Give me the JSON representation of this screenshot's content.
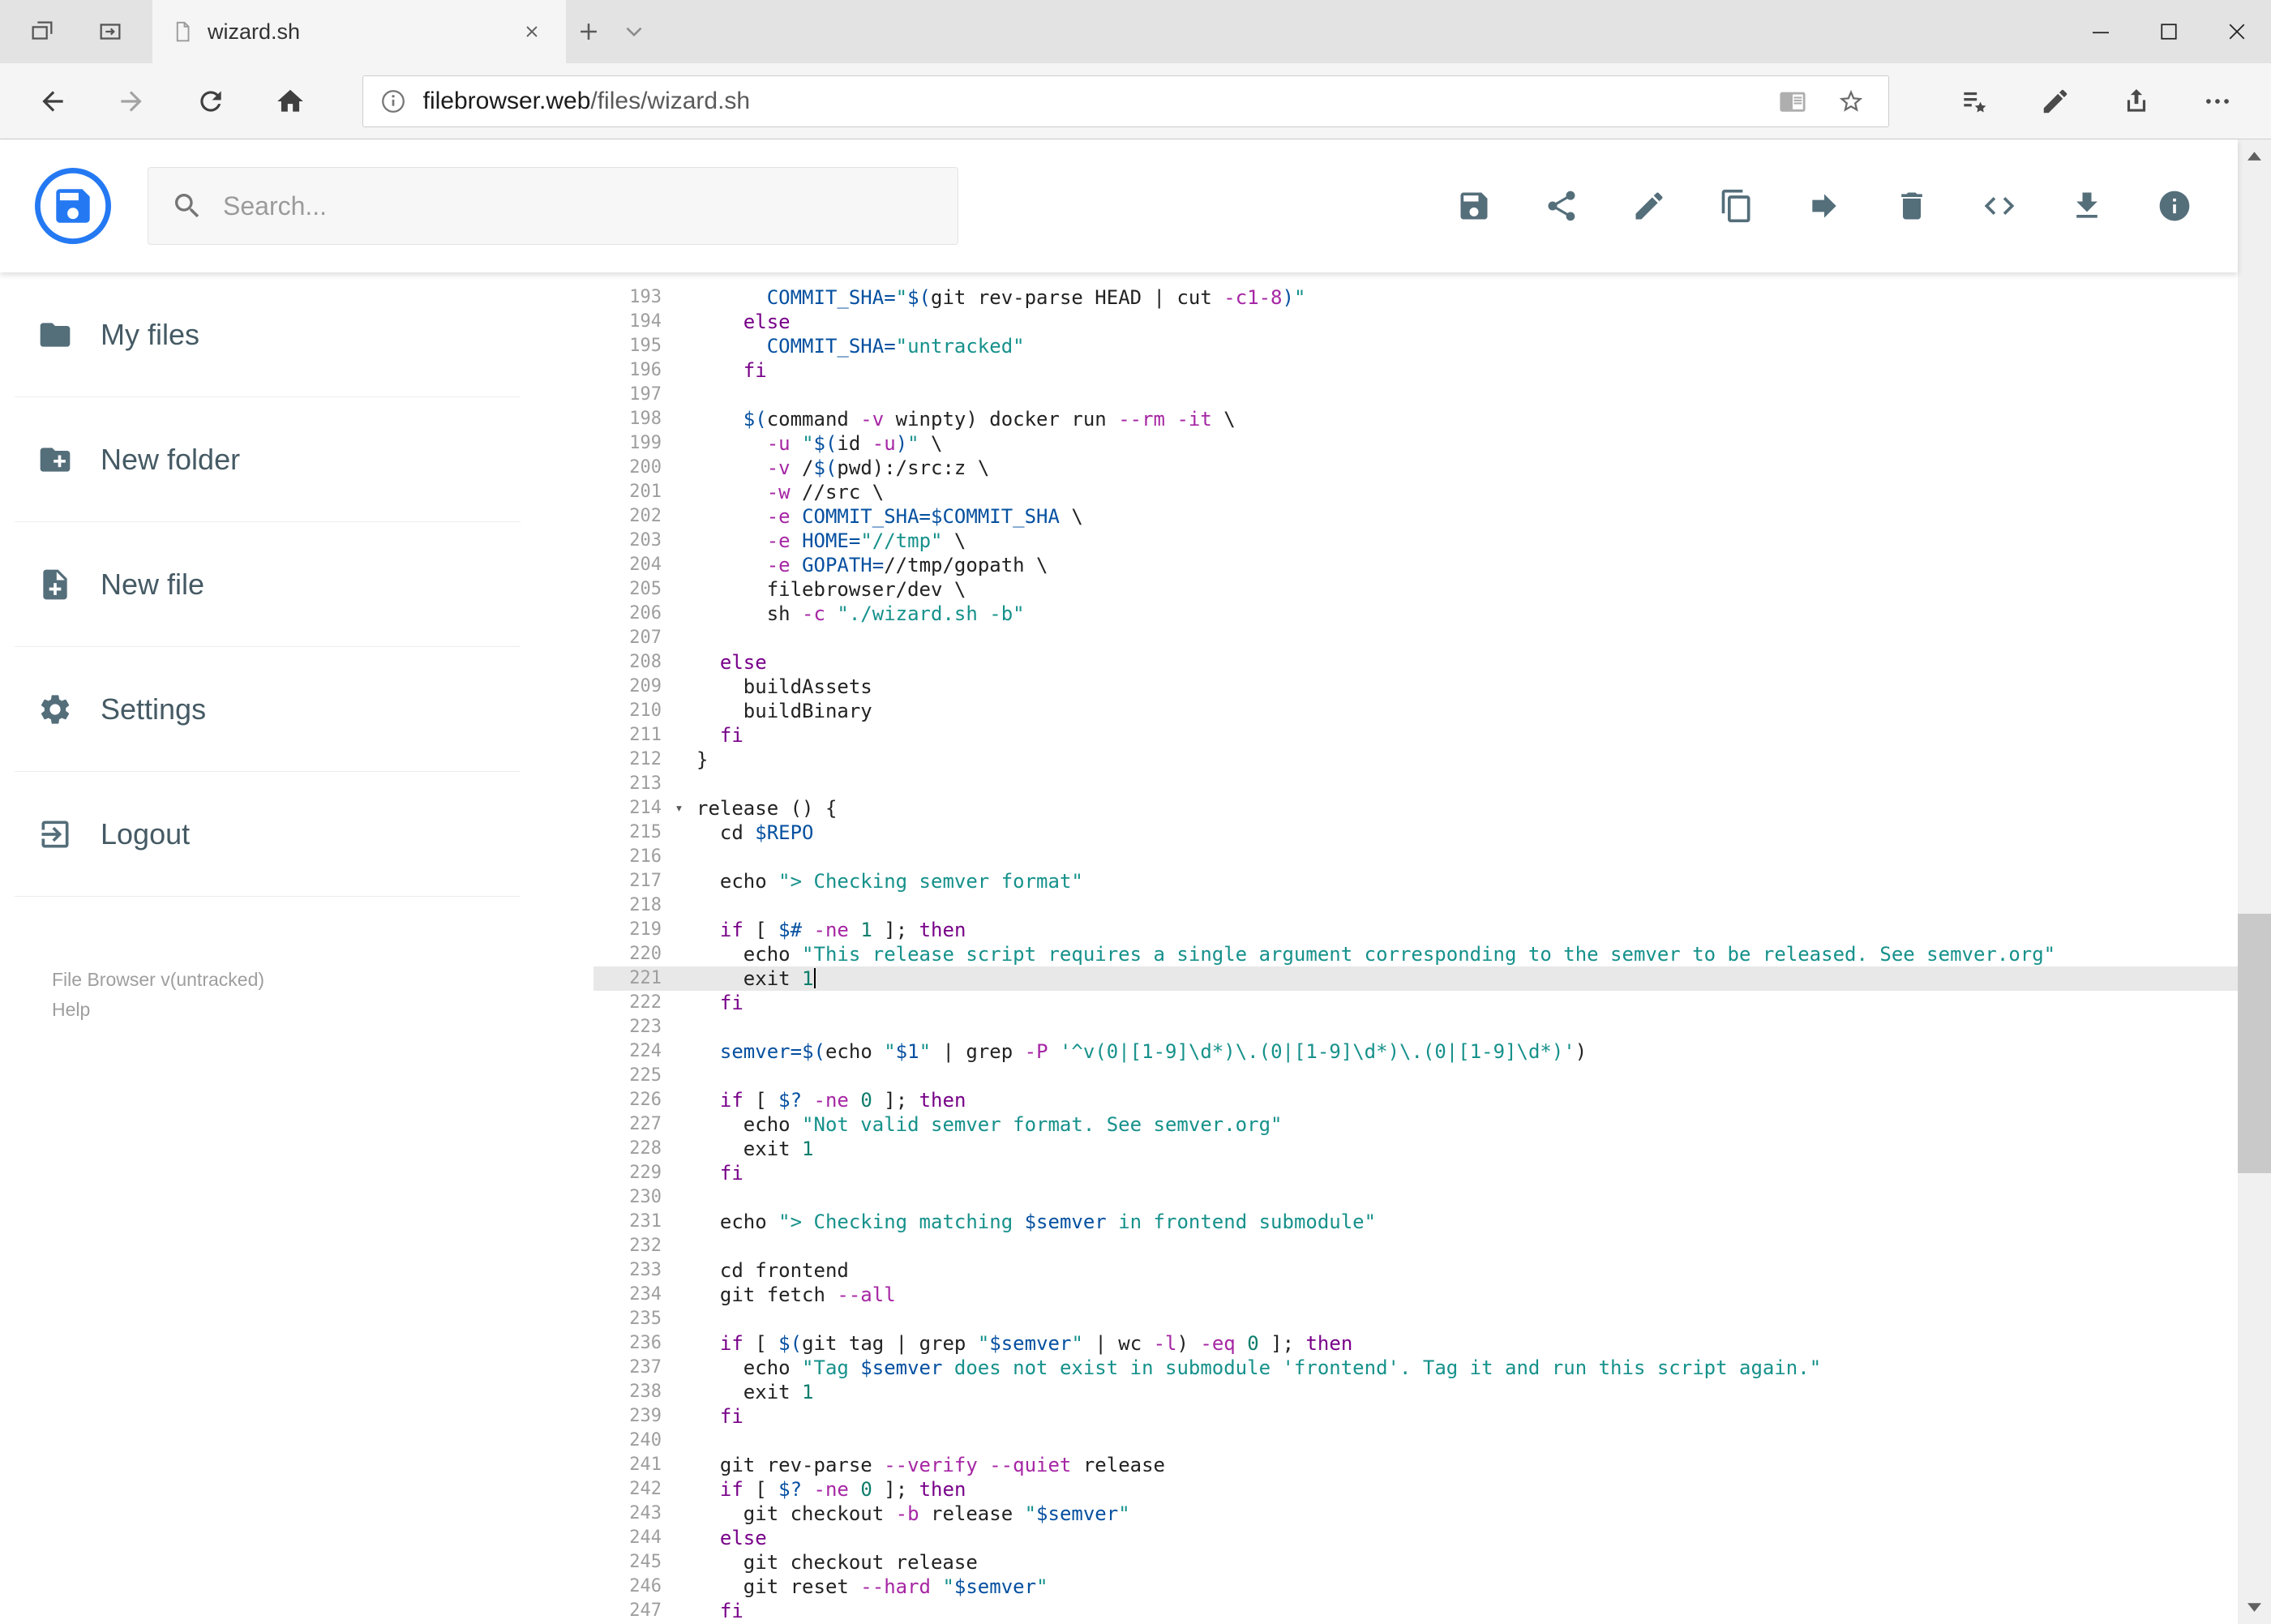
{
  "window": {
    "tab_title": "wizard.sh"
  },
  "browser": {
    "url_domain": "filebrowser.web",
    "url_path": "/files/wizard.sh"
  },
  "app": {
    "search_placeholder": "Search...",
    "toolbar": [
      "save",
      "share",
      "rename",
      "copy",
      "move",
      "delete",
      "raw",
      "download",
      "info"
    ],
    "sidebar": [
      {
        "icon": "folder",
        "label": "My files"
      },
      {
        "icon": "new-folder",
        "label": "New folder"
      },
      {
        "icon": "new-file",
        "label": "New file"
      },
      {
        "icon": "settings",
        "label": "Settings"
      },
      {
        "icon": "logout",
        "label": "Logout"
      }
    ],
    "footer_version": "File Browser v(untracked)",
    "footer_help": "Help"
  },
  "editor": {
    "first_line": 193,
    "active_line": 221,
    "fold_marker_line": 214,
    "colors": {
      "text": "#222222",
      "keyword": "#770088",
      "string": "#16918b",
      "variable": "#0550a0",
      "flag": "#a626a4",
      "number": "#0d7d6c",
      "gutter": "#9e9e9e",
      "active_line_bg": "#e8e8e8"
    },
    "lines": [
      "      COMMIT_SHA=\"$(git rev-parse HEAD | cut -c1-8)\"",
      "    else",
      "      COMMIT_SHA=\"untracked\"",
      "    fi",
      "",
      "    $(command -v winpty) docker run --rm -it \\",
      "      -u \"$(id -u)\" \\",
      "      -v /$(pwd):/src:z \\",
      "      -w //src \\",
      "      -e COMMIT_SHA=$COMMIT_SHA \\",
      "      -e HOME=\"//tmp\" \\",
      "      -e GOPATH=//tmp/gopath \\",
      "      filebrowser/dev \\",
      "      sh -c \"./wizard.sh -b\"",
      "",
      "  else",
      "    buildAssets",
      "    buildBinary",
      "  fi",
      "}",
      "",
      "release () {",
      "  cd $REPO",
      "",
      "  echo \"> Checking semver format\"",
      "",
      "  if [ $# -ne 1 ]; then",
      "    echo \"This release script requires a single argument corresponding to the semver to be released. See semver.org\"",
      "    exit 1",
      "  fi",
      "",
      "  semver=$(echo \"$1\" | grep -P '^v(0|[1-9]\\d*)\\.(0|[1-9]\\d*)\\.(0|[1-9]\\d*)')",
      "",
      "  if [ $? -ne 0 ]; then",
      "    echo \"Not valid semver format. See semver.org\"",
      "    exit 1",
      "  fi",
      "",
      "  echo \"> Checking matching $semver in frontend submodule\"",
      "",
      "  cd frontend",
      "  git fetch --all",
      "",
      "  if [ $(git tag | grep \"$semver\" | wc -l) -eq 0 ]; then",
      "    echo \"Tag $semver does not exist in submodule 'frontend'. Tag it and run this script again.\"",
      "    exit 1",
      "  fi",
      "",
      "  git rev-parse --verify --quiet release",
      "  if [ $? -ne 0 ]; then",
      "    git checkout -b release \"$semver\"",
      "  else",
      "    git checkout release",
      "    git reset --hard \"$semver\"",
      "  fi"
    ]
  }
}
